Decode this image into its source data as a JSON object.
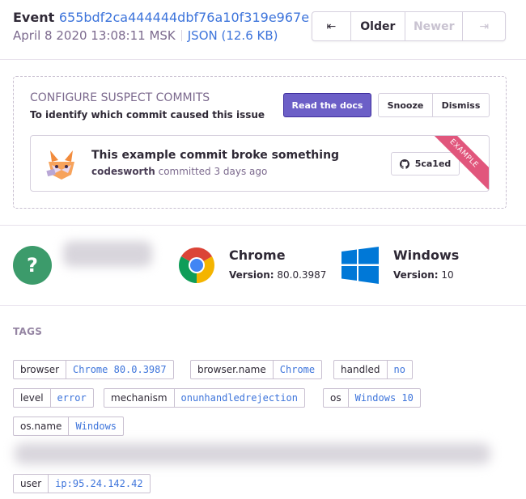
{
  "header": {
    "event_label": "Event",
    "event_id": "655bdf2ca444444dbf76a10f319e967e",
    "timestamp": "April 8 2020 13:08:11 MSK",
    "json_link": "JSON (12.6 KB)"
  },
  "pager": {
    "first_glyph": "⇤",
    "older": "Older",
    "newer": "Newer",
    "last_glyph": "⇥"
  },
  "suspect_commits": {
    "heading": "CONFIGURE SUSPECT COMMITS",
    "subheading": "To identify which commit caused this issue",
    "docs_button": "Read the docs",
    "snooze_button": "Snooze",
    "dismiss_button": "Dismiss",
    "commit": {
      "title": "This example commit broke something",
      "author": "codesworth",
      "action": "committed 3 days ago",
      "sha": "5ca1ed",
      "ribbon": "EXAMPLE"
    }
  },
  "context": {
    "user_icon_glyph": "?",
    "browser": {
      "name": "Chrome",
      "version_label": "Version:",
      "version": "80.0.3987"
    },
    "os": {
      "name": "Windows",
      "version_label": "Version:",
      "version": "10"
    }
  },
  "tags": {
    "heading": "TAGS",
    "items": [
      {
        "key": "browser",
        "value": "Chrome 80.0.3987"
      },
      {
        "key": "browser.name",
        "value": "Chrome"
      },
      {
        "key": "handled",
        "value": "no"
      },
      {
        "key": "level",
        "value": "error"
      },
      {
        "key": "mechanism",
        "value": "onunhandledrejection"
      },
      {
        "key": "os",
        "value": "Windows 10"
      },
      {
        "key": "os.name",
        "value": "Windows"
      },
      {
        "key": "user",
        "value": "ip:95.24.142.42"
      }
    ]
  },
  "colors": {
    "accent": "#6c5fc7",
    "link": "#3d74db",
    "user_icon": "#3c9b6b",
    "ribbon": "#e1567c",
    "windows": "#0078d7"
  },
  "icons": [
    "first-page-icon",
    "last-page-icon",
    "github-icon",
    "commit-avatar-icon",
    "unknown-user-icon",
    "chrome-icon",
    "windows-icon"
  ]
}
